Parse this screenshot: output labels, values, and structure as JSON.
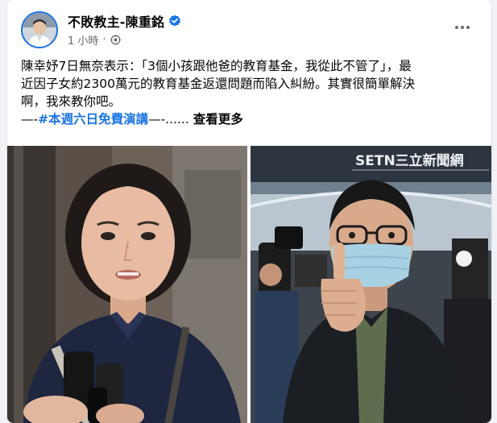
{
  "post": {
    "author_name": "不敗教主-陳重銘",
    "timestamp": "1 小時",
    "meta_separator": "·",
    "text_lines": [
      "陳幸妤7日無奈表示：「3個小孩跟他爸的教育基金，我從此不管了」，最",
      "近因子女約2300萬元的教育基金返還問題而陷入糾紛。其實很簡單解決",
      "啊，我來教你吧。"
    ],
    "hashtag_prefix": "—-",
    "hashtag": "#本週六日免費演講",
    "hashtag_suffix": "—-......",
    "see_more_label": "查看更多"
  },
  "icons": {
    "verified": "verified-badge-icon",
    "privacy": "globe-icon",
    "more": "more-options-icon"
  },
  "photo_right": {
    "watermark": "SETN三立新聞網"
  },
  "colors": {
    "accent": "#1b74e4",
    "secondary_text": "#65676b",
    "card_bg": "#ffffff",
    "page_bg": "#f0f2f5"
  }
}
